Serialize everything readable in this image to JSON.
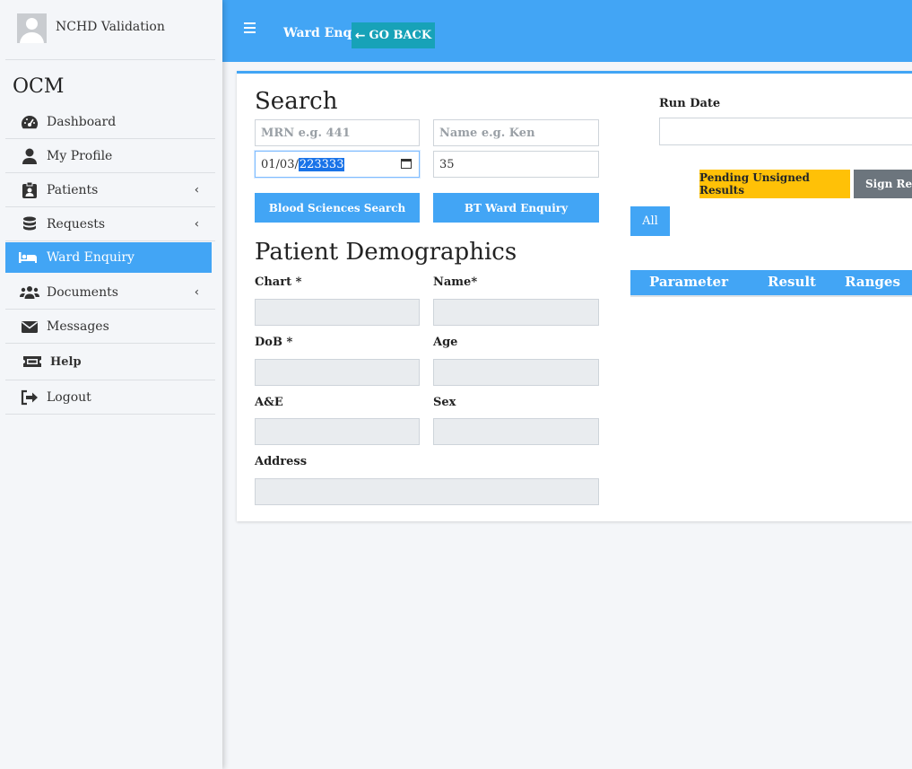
{
  "user": {
    "name": "NCHD Validation"
  },
  "brand": "OCM",
  "nav": [
    {
      "label": "Dashboard",
      "icon": "dashboard-icon",
      "has_submenu": false
    },
    {
      "label": "My Profile",
      "icon": "user-icon",
      "has_submenu": false
    },
    {
      "label": "Patients",
      "icon": "id-badge-icon",
      "has_submenu": true
    },
    {
      "label": "Requests",
      "icon": "database-icon",
      "has_submenu": true
    },
    {
      "label": "Ward Enquiry",
      "icon": "bed-icon",
      "has_submenu": false,
      "active": true
    },
    {
      "label": "Documents",
      "icon": "users-icon",
      "has_submenu": true
    },
    {
      "label": "Messages",
      "icon": "envelope-icon",
      "has_submenu": false
    },
    {
      "label": "Help",
      "icon": "ticket-icon",
      "has_submenu": false
    },
    {
      "label": "Logout",
      "icon": "sign-out-icon",
      "has_submenu": false
    }
  ],
  "header": {
    "page_label": "Ward Enq",
    "go_back_label": "GO BACK"
  },
  "search": {
    "title": "Search",
    "mrn_placeholder": "MRN e.g. 441",
    "name_placeholder": "Name e.g. Ken",
    "date_prefix": "01/03/",
    "date_selected": "223333",
    "number_value": "35",
    "blood_sciences_button": "Blood Sciences Search",
    "bt_ward_button": "BT Ward Enquiry"
  },
  "demographics": {
    "title": "Patient Demographics",
    "chart_label": "Chart *",
    "name_label": "Name*",
    "dob_label": "DoB *",
    "age_label": "Age",
    "ae_label": "A&E",
    "sex_label": "Sex",
    "address_label": "Address"
  },
  "results": {
    "run_date_label": "Run Date",
    "pending_button": "Pending Unsigned Results",
    "sign_button": "Sign Results",
    "all_button": "All",
    "columns": [
      "Parameter",
      "Result",
      "Ranges"
    ]
  },
  "colors": {
    "primary": "#42a5f5",
    "info": "#17a2b8",
    "warning": "#ffc107",
    "secondary": "#6c757d"
  }
}
